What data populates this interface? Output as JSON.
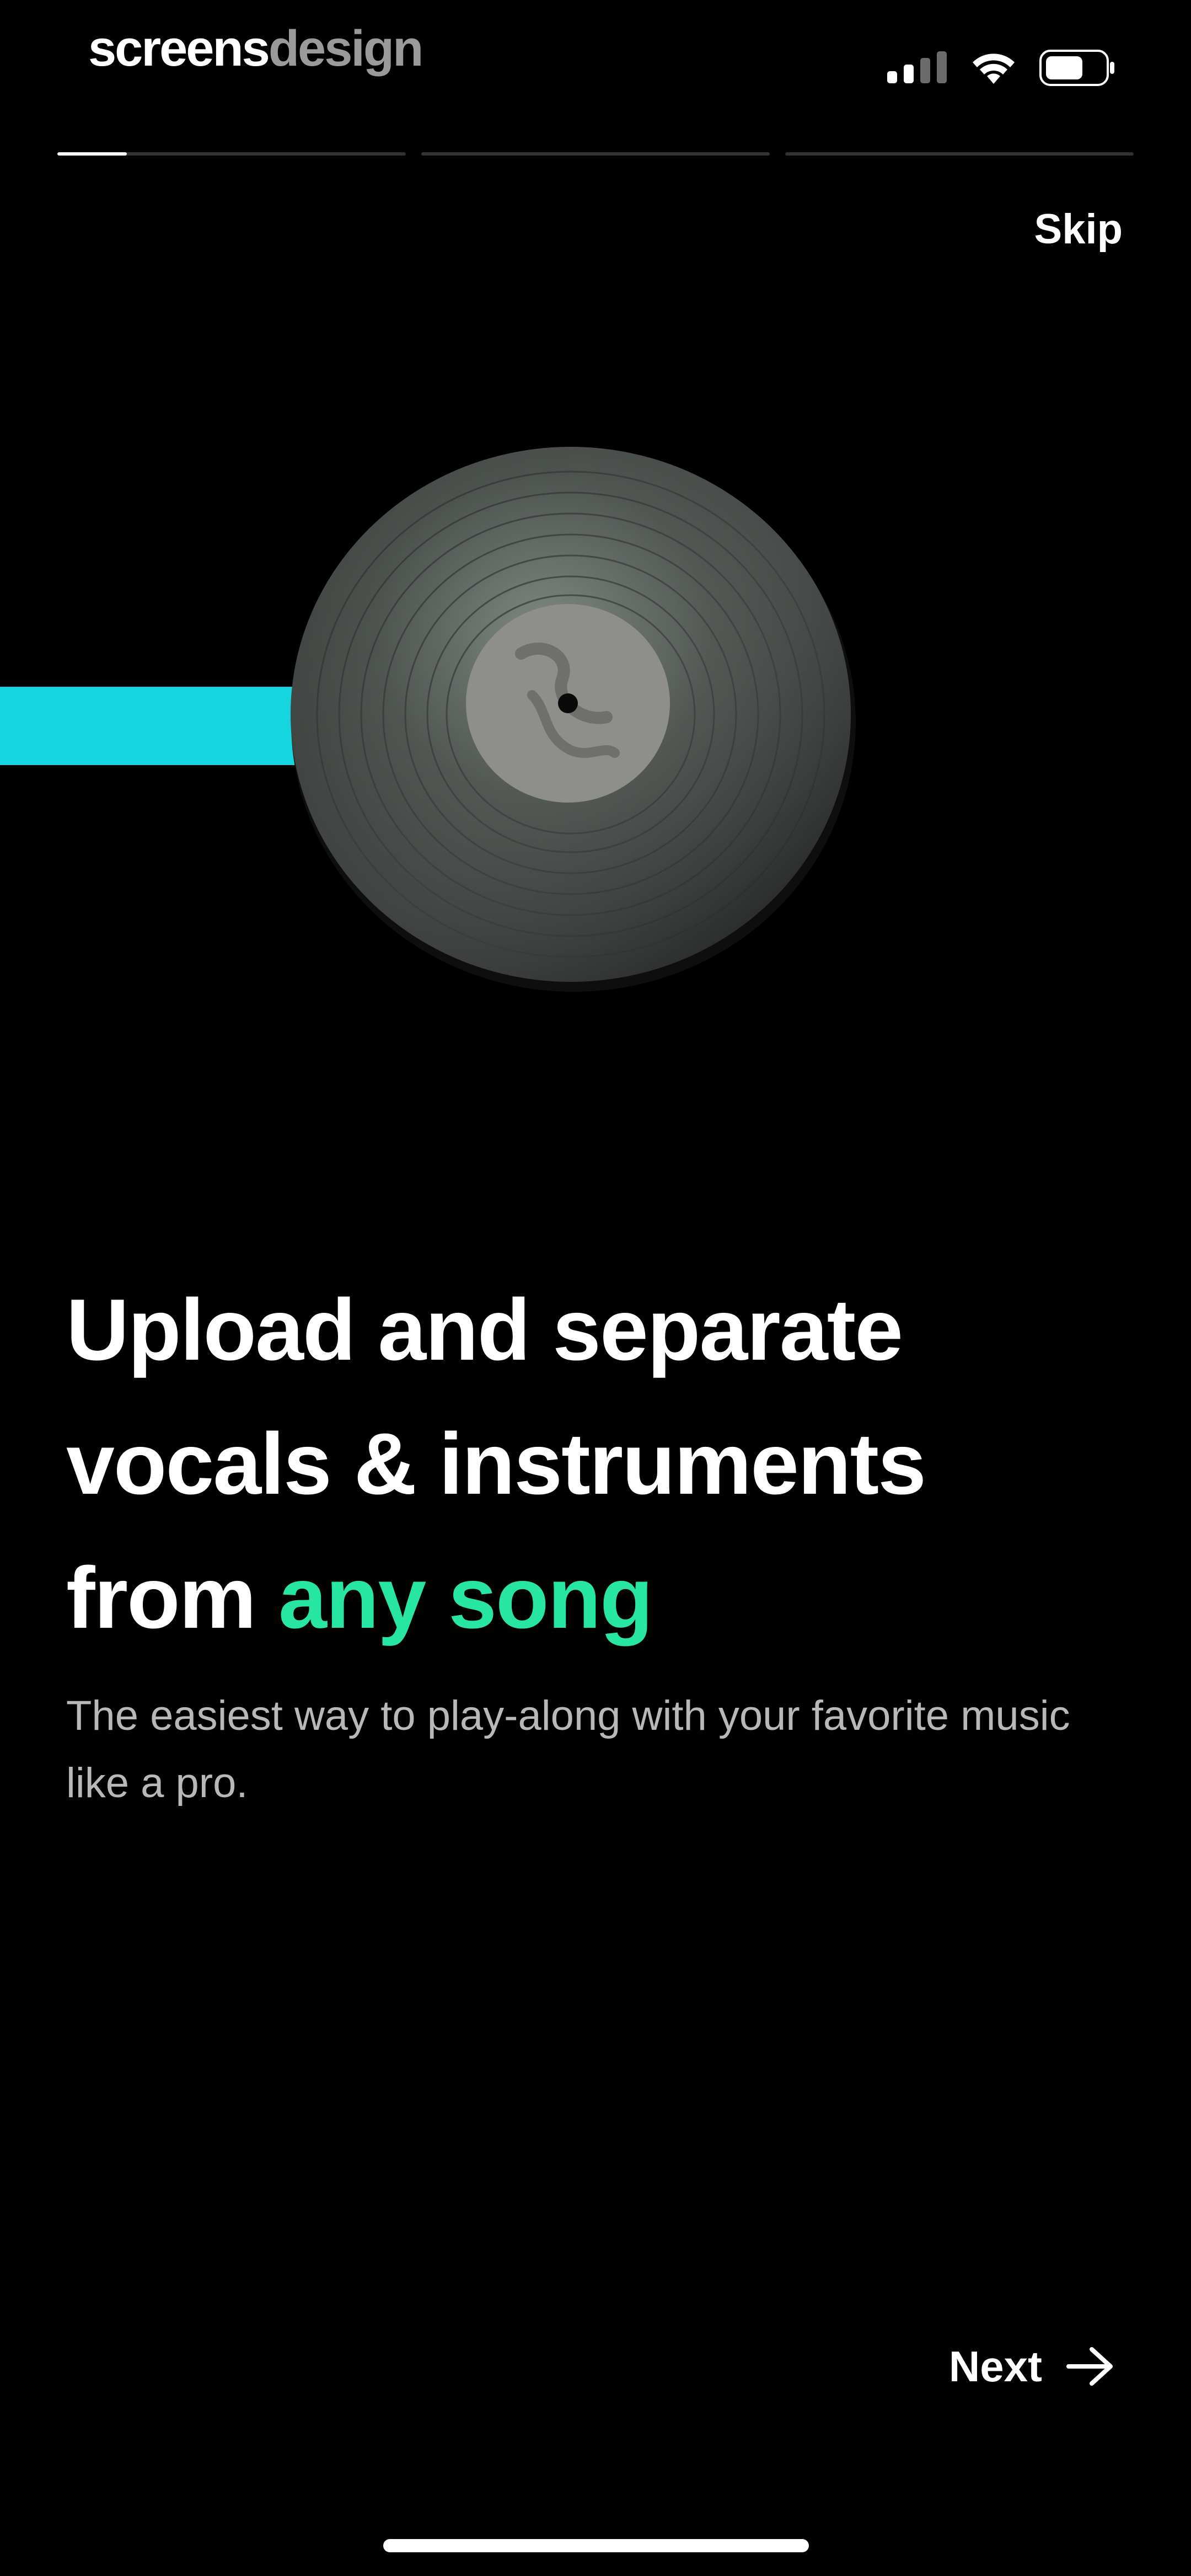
{
  "status_bar": {
    "brand_part1": "screens",
    "brand_part2": "design",
    "icons": [
      "cellular-signal-icon",
      "wifi-icon",
      "battery-icon"
    ]
  },
  "onboarding": {
    "total_steps": 3,
    "current_step": 1,
    "current_step_progress": 0.2,
    "skip_label": "Skip",
    "next_label": "Next"
  },
  "hero": {
    "bar_color": "#15d6df",
    "image": "vinyl-record"
  },
  "headline": {
    "line1": "Upload and separate",
    "line2": "vocals & instruments",
    "line3_prefix": "from ",
    "line3_accent": "any song",
    "accent_color": "#27e6a1"
  },
  "subtitle": "The easiest way to play-along with your favorite music like a pro."
}
